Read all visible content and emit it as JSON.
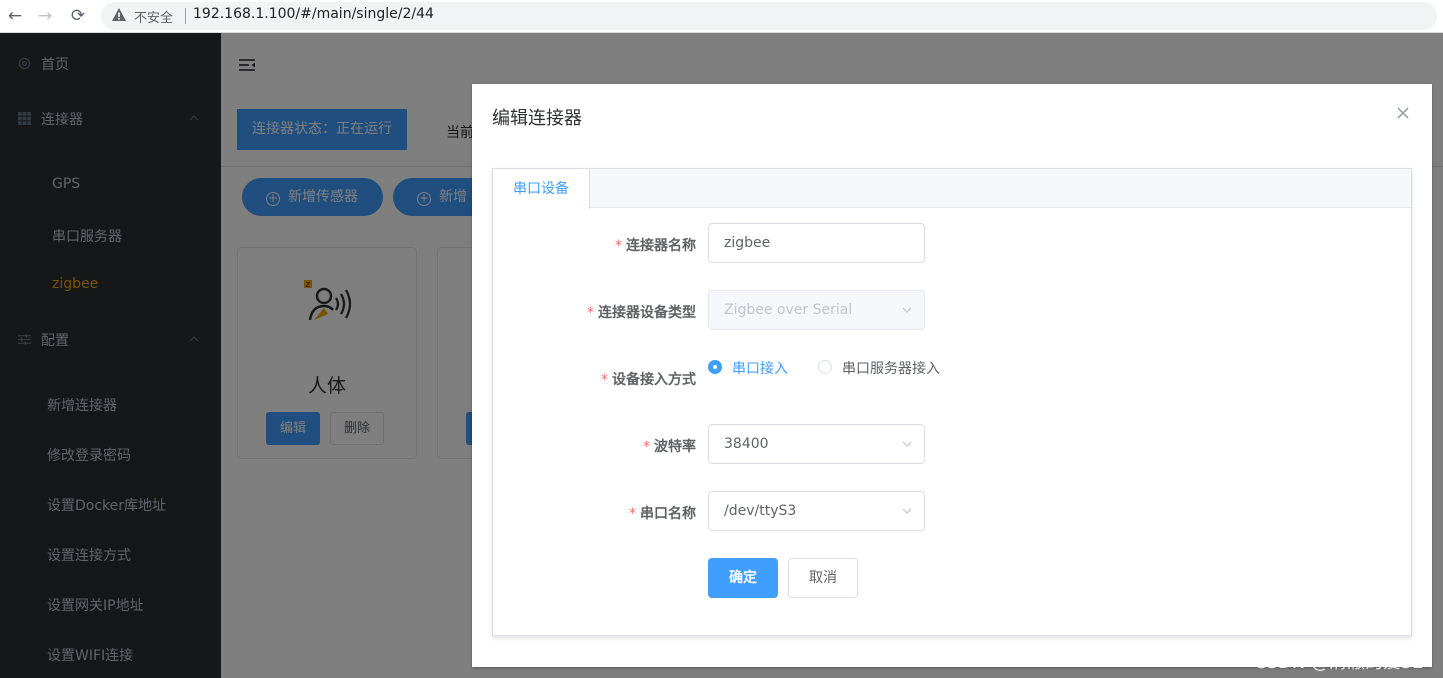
{
  "browser": {
    "insecure_label": "不安全",
    "url": "192.168.1.100/#/main/single/2/44"
  },
  "sidebar": {
    "items": [
      {
        "label": "首页",
        "icon": "gear-icon"
      },
      {
        "label": "连接器",
        "icon": "grid-icon"
      },
      {
        "label": "GPS"
      },
      {
        "label": "串口服务器"
      },
      {
        "label": "zigbee",
        "active": true
      },
      {
        "label": "配置",
        "icon": "sliders-icon"
      },
      {
        "label": "新增连接器"
      },
      {
        "label": "修改登录密码"
      },
      {
        "label": "设置Docker库地址"
      },
      {
        "label": "设置连接方式"
      },
      {
        "label": "设置网关IP地址"
      },
      {
        "label": "设置WIFI连接"
      }
    ]
  },
  "main": {
    "status": "连接器状态：正在运行",
    "current_prefix": "当前",
    "buttons": {
      "add_sensor": "新增传感器",
      "add_other": "新增"
    },
    "cards": [
      {
        "title": "人体",
        "edit": "编辑",
        "delete": "删除",
        "icon": "zigbee-person-sensor-icon"
      },
      {
        "title": "",
        "edit": "",
        "delete": ""
      }
    ]
  },
  "dialog": {
    "title": "编辑连接器",
    "tab": "串口设备",
    "fields": {
      "name": {
        "label": "连接器名称",
        "value": "zigbee"
      },
      "device_type": {
        "label": "连接器设备类型",
        "value": "Zigbee over Serial",
        "disabled": true
      },
      "access_mode": {
        "label": "设备接入方式",
        "options": [
          "串口接入",
          "串口服务器接入"
        ],
        "selected": "串口接入"
      },
      "baud_rate": {
        "label": "波特率",
        "value": "38400"
      },
      "serial_port": {
        "label": "串口名称",
        "value": "/dev/ttyS3"
      }
    },
    "ok": "确定",
    "cancel": "取消"
  },
  "watermark": "CSDN @清澈的爱52",
  "colors": {
    "primary": "#409eff",
    "sidebar_bg": "#2a2e32",
    "sidebar_text": "#bfcbd9",
    "active": "#f0a70a",
    "required": "#f56c6c"
  }
}
